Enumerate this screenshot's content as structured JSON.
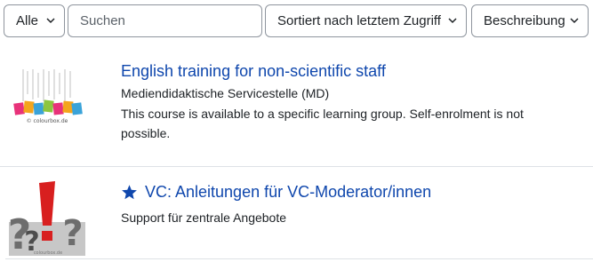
{
  "filters": {
    "grouping": "Alle",
    "search_placeholder": "Suchen",
    "sort": "Sortiert nach letztem Zugriff",
    "display": "Beschreibung"
  },
  "courses": [
    {
      "title": "English training for non-scientific staff",
      "category": "Mediendidaktische Servicestelle (MD)",
      "description": "This course is available to a specific learning group. Self-enrolment is not possible.",
      "thumbnail_credit": "© colourbox.de",
      "starred": false
    },
    {
      "title": "VC: Anleitungen für VC-Moderator/innen",
      "category": "Support für zentrale Angebote",
      "thumbnail_credit": "colourbox.de",
      "starred": true
    }
  ],
  "colors": {
    "link": "#0f47ad",
    "star": "#0f47ad",
    "border": "#8f959e",
    "divider": "#dee2e6"
  }
}
